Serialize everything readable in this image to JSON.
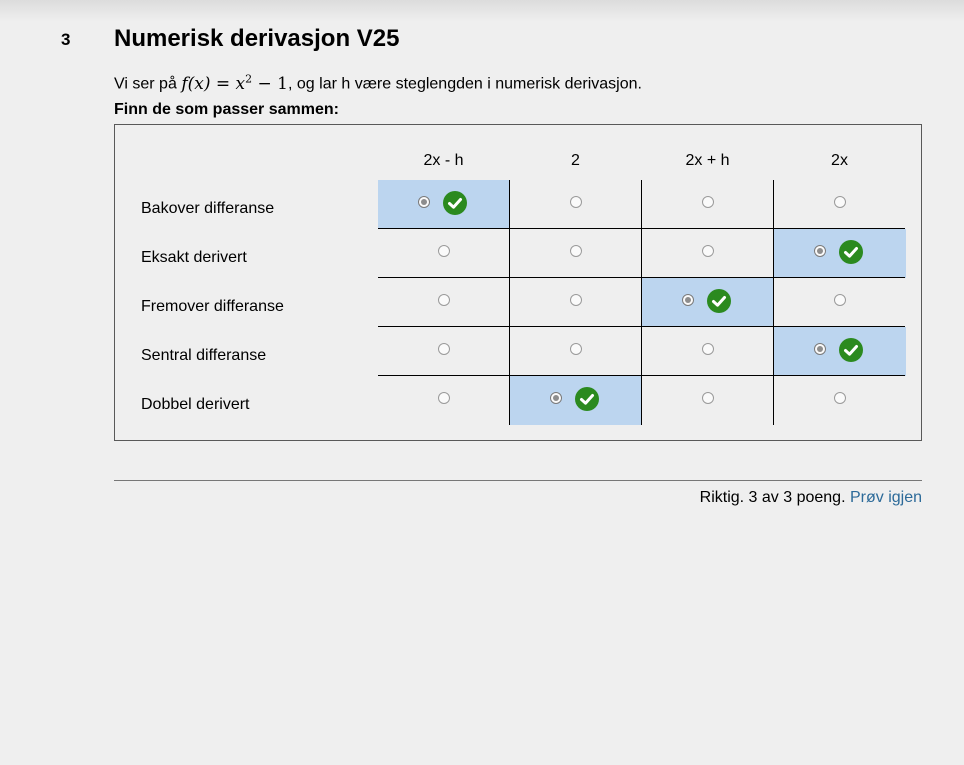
{
  "question": {
    "number": "3",
    "title": "Numerisk derivasjon V25",
    "intro_before": "Vi ser på",
    "intro_after": ", og lar h være steglengden i numerisk derivasjon.",
    "formula": {
      "lhs": "f(x)",
      "eq": "=",
      "base": "x",
      "exp": "2",
      "rest": "− 1"
    },
    "instruction": "Finn de som passer sammen:"
  },
  "matrix": {
    "columns": [
      "2x - h",
      "2",
      "2x + h",
      "2x"
    ],
    "rows": [
      {
        "label": "Bakover differanse",
        "selected": 0
      },
      {
        "label": "Eksakt derivert",
        "selected": 3
      },
      {
        "label": "Fremover differanse",
        "selected": 2
      },
      {
        "label": "Sentral differanse",
        "selected": 3
      },
      {
        "label": "Dobbel derivert",
        "selected": 1
      }
    ],
    "selection_color": "#bcd5ef",
    "correct_icon": "check-circle-icon",
    "correct_color": "#2b8a1f"
  },
  "feedback": {
    "result_text": "Riktig. 3 av 3 poeng.",
    "retry_label": "Prøv igjen",
    "retry_color": "#2c6a99"
  }
}
